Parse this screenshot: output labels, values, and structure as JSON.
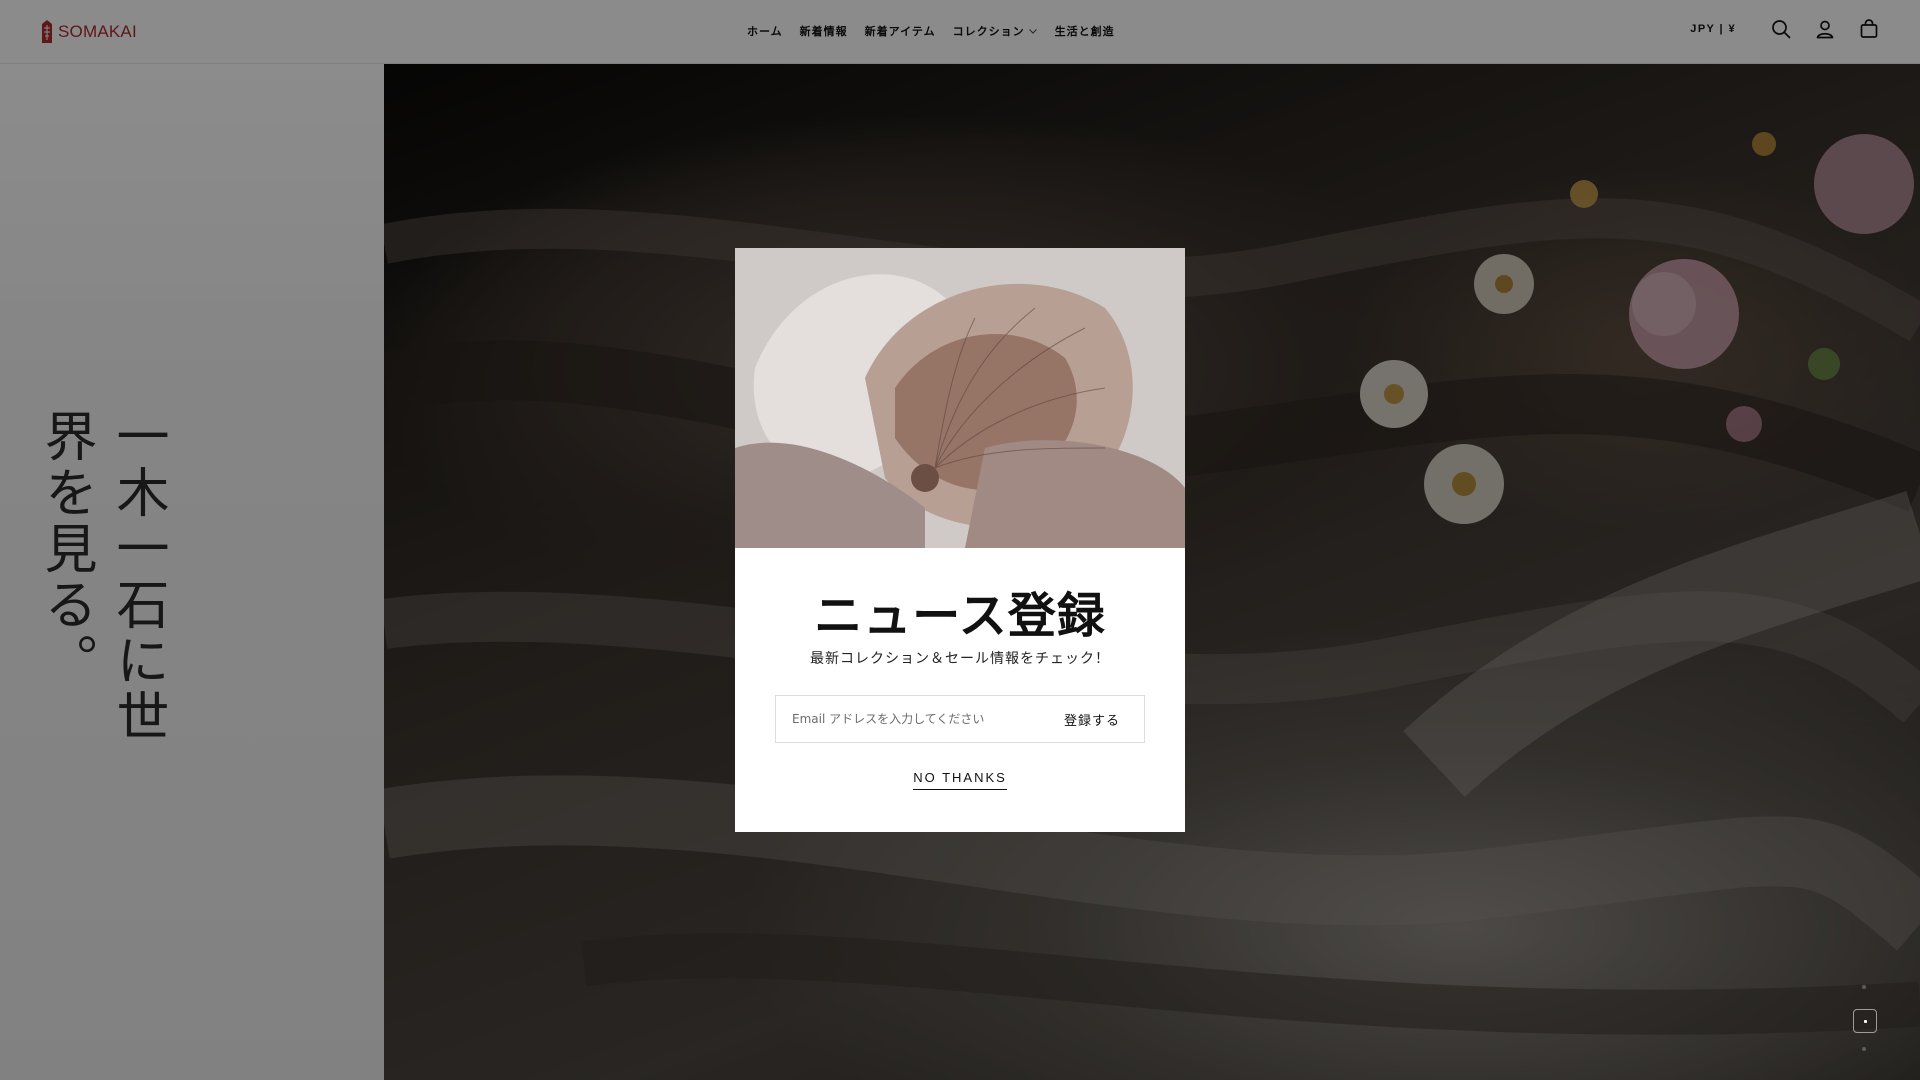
{
  "header": {
    "brand": "SOMAKAI",
    "nav": [
      {
        "label": "ホーム"
      },
      {
        "label": "新着情報"
      },
      {
        "label": "新着アイテム"
      },
      {
        "label": "コレクション",
        "has_dropdown": true
      },
      {
        "label": "生活と創造"
      }
    ],
    "currency": "JPY | ¥",
    "icons": [
      "search-icon",
      "account-icon",
      "cart-icon"
    ]
  },
  "hero": {
    "vertical_text": "一木一石に世界を見る。"
  },
  "popup": {
    "title": "ニュース登録",
    "subtitle": "最新コレクション＆セール情報をチェック！",
    "email_placeholder": "Email アドレスを入力してください",
    "email_value": "",
    "submit_label": "登録する",
    "dismiss_label": "NO THANKS"
  },
  "slider": {
    "current": 1,
    "total": 1
  },
  "colors": {
    "brand": "#b02a2a",
    "overlay": "#000000"
  }
}
